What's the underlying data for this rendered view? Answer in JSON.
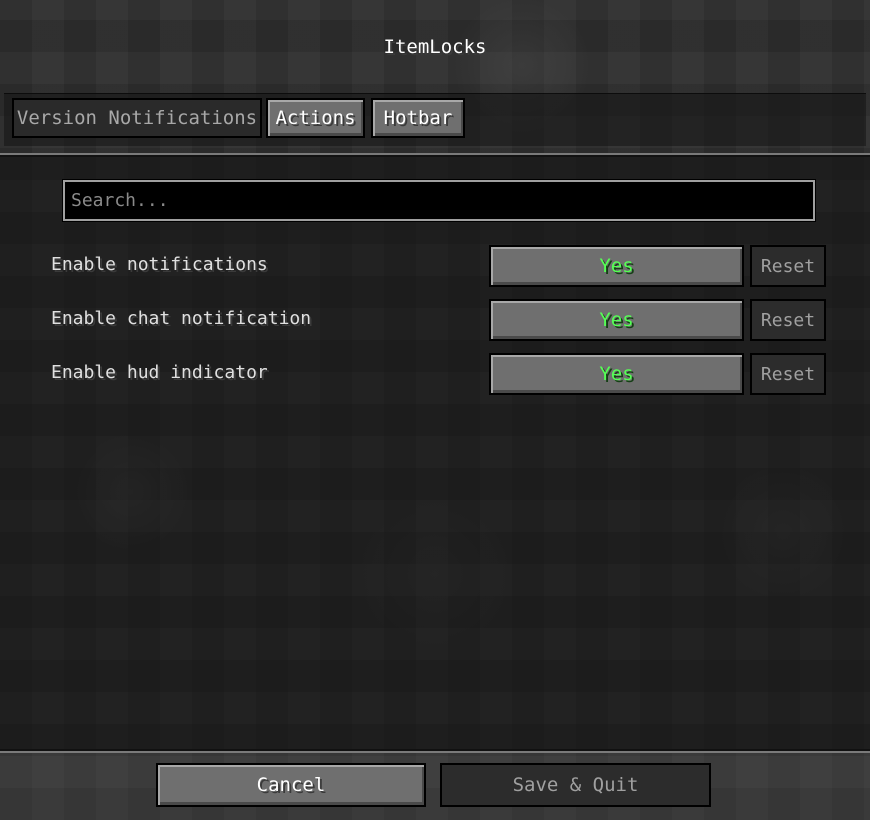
{
  "window": {
    "title": "ItemLocks"
  },
  "tabs": [
    {
      "label": "Version Notifications",
      "state": "inactive"
    },
    {
      "label": "Actions",
      "state": "active"
    },
    {
      "label": "Hotbar",
      "state": "active"
    }
  ],
  "search": {
    "placeholder": "Search...",
    "value": ""
  },
  "options": [
    {
      "label": "Enable notifications",
      "value": "Yes",
      "reset_label": "Reset"
    },
    {
      "label": "Enable chat notification",
      "value": "Yes",
      "reset_label": "Reset"
    },
    {
      "label": "Enable hud indicator",
      "value": "Yes",
      "reset_label": "Reset"
    }
  ],
  "footer": {
    "cancel_label": "Cancel",
    "save_label": "Save & Quit"
  },
  "colors": {
    "value_true": "#55ff55",
    "button_bg": "#6f6f6f",
    "disabled_bg": "#2c2c2c"
  }
}
